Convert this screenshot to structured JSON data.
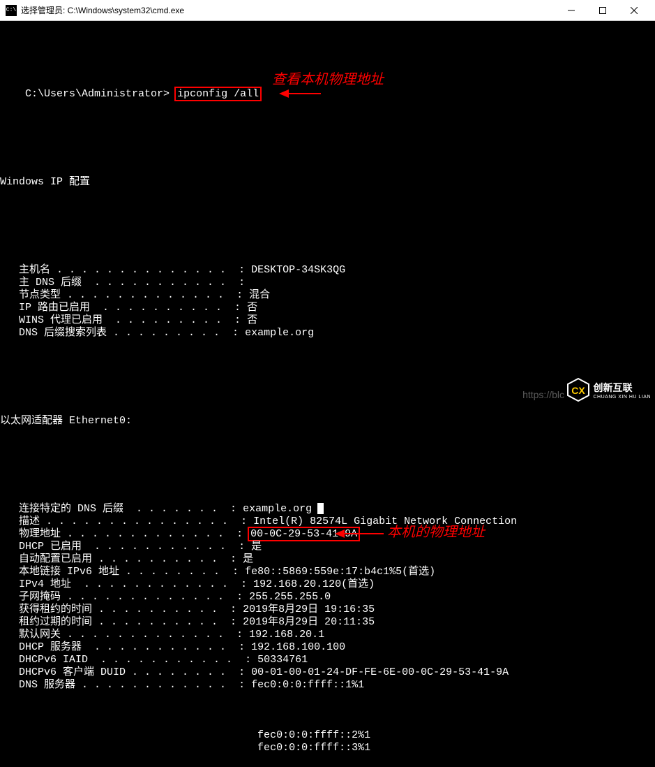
{
  "titlebar": {
    "icon_label": "C:\\",
    "title": "选择管理员: C:\\Windows\\system32\\cmd.exe"
  },
  "prompt": {
    "path": "C:\\Users\\Administrator>",
    "command": "ipconfig /all"
  },
  "annotations": {
    "cmd_note": "查看本机物理地址",
    "mac_note": "本机的物理地址"
  },
  "section_headers": {
    "ipconfig": "Windows IP 配置",
    "adapter": "以太网适配器 Ethernet0:"
  },
  "ipconfig_rows": [
    {
      "label": "   主机名 ",
      "value": "DESKTOP-34SK3QG"
    },
    {
      "label": "   主 DNS 后缀 ",
      "value": ""
    },
    {
      "label": "   节点类型 ",
      "value": "混合"
    },
    {
      "label": "   IP 路由已启用 ",
      "value": "否"
    },
    {
      "label": "   WINS 代理已启用 ",
      "value": "否"
    },
    {
      "label": "   DNS 后缀搜索列表 ",
      "value": "example.org"
    }
  ],
  "adapter_rows": [
    {
      "label": "   连接特定的 DNS 后缀 ",
      "value": "example.org",
      "cursor": true
    },
    {
      "label": "   描述",
      "value": "Intel(R) 82574L Gigabit Network Connection"
    },
    {
      "label": "   物理地址",
      "value": "00-0C-29-53-41-9A",
      "highlight": true
    },
    {
      "label": "   DHCP 已启用 ",
      "value": "是"
    },
    {
      "label": "   自动配置已启用",
      "value": "是"
    },
    {
      "label": "   本地链接 IPv6 地址",
      "value": "fe80::5869:559e:17:b4c1%5(首选)"
    },
    {
      "label": "   IPv4 地址 ",
      "value": "192.168.20.120(首选)"
    },
    {
      "label": "   子网掩码 ",
      "value": "255.255.255.0"
    },
    {
      "label": "   获得租约的时间 ",
      "value": "2019年8月29日 19:16:35"
    },
    {
      "label": "   租约过期的时间 ",
      "value": "2019年8月29日 20:11:35"
    },
    {
      "label": "   默认网关",
      "value": "192.168.20.1"
    },
    {
      "label": "   DHCP 服务器 ",
      "value": "192.168.100.100"
    },
    {
      "label": "   DHCPv6 IAID ",
      "value": "50334761"
    },
    {
      "label": "   DHCPv6 客户端 DUID ",
      "value": "00-01-00-01-24-DF-FE-6E-00-0C-29-53-41-9A"
    },
    {
      "label": "   DNS 服务器 ",
      "value": "fec0:0:0:ffff::1%1"
    }
  ],
  "dns_extra": [
    "fec0:0:0:ffff::2%1",
    "fec0:0:0:ffff::3%1"
  ],
  "watermark": {
    "url": "https://blc",
    "brand_cn": "创新互联",
    "brand_en": "CHUANG XIN HU LIAN"
  }
}
